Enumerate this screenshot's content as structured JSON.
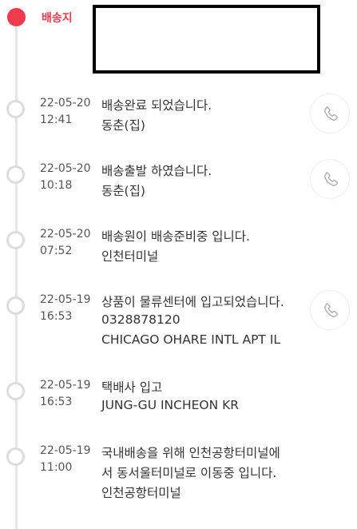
{
  "destination": {
    "label": "배송지"
  },
  "events": [
    {
      "date": "22-05-20",
      "time": "12:41",
      "lines": [
        "배송완료 되었습니다.",
        "동춘(집)"
      ],
      "has_call": true
    },
    {
      "date": "22-05-20",
      "time": "10:18",
      "lines": [
        "배송출발 하였습니다.",
        "동춘(집)"
      ],
      "has_call": true
    },
    {
      "date": "22-05-20",
      "time": "07:52",
      "lines": [
        "배송원이 배송준비중 입니다.",
        "인천터미널"
      ],
      "has_call": false
    },
    {
      "date": "22-05-19",
      "time": "16:53",
      "lines": [
        "상품이 물류센터에 입고되었습니다.",
        "0328878120",
        "CHICAGO OHARE INTL APT IL"
      ],
      "has_call": true
    },
    {
      "date": "22-05-19",
      "time": "16:53",
      "lines": [
        "택배사 입고",
        "JUNG-GU INCHEON KR"
      ],
      "has_call": false
    },
    {
      "date": "22-05-19",
      "time": "11:00",
      "lines": [
        "국내배송을 위해 인천공항터미널에",
        "서 동서울터미널로 이동중 입니다.",
        "인천공항터미널"
      ],
      "has_call": false
    }
  ],
  "icons": {
    "call": "phone-icon",
    "current_stop": "timeline-dot-active-icon",
    "past_stop": "timeline-dot-icon"
  },
  "colors": {
    "accent": "#ef3b4c",
    "timeline": "#e5e5e5",
    "dot_border": "#dcdcdc",
    "icon": "#aaaaaa"
  }
}
